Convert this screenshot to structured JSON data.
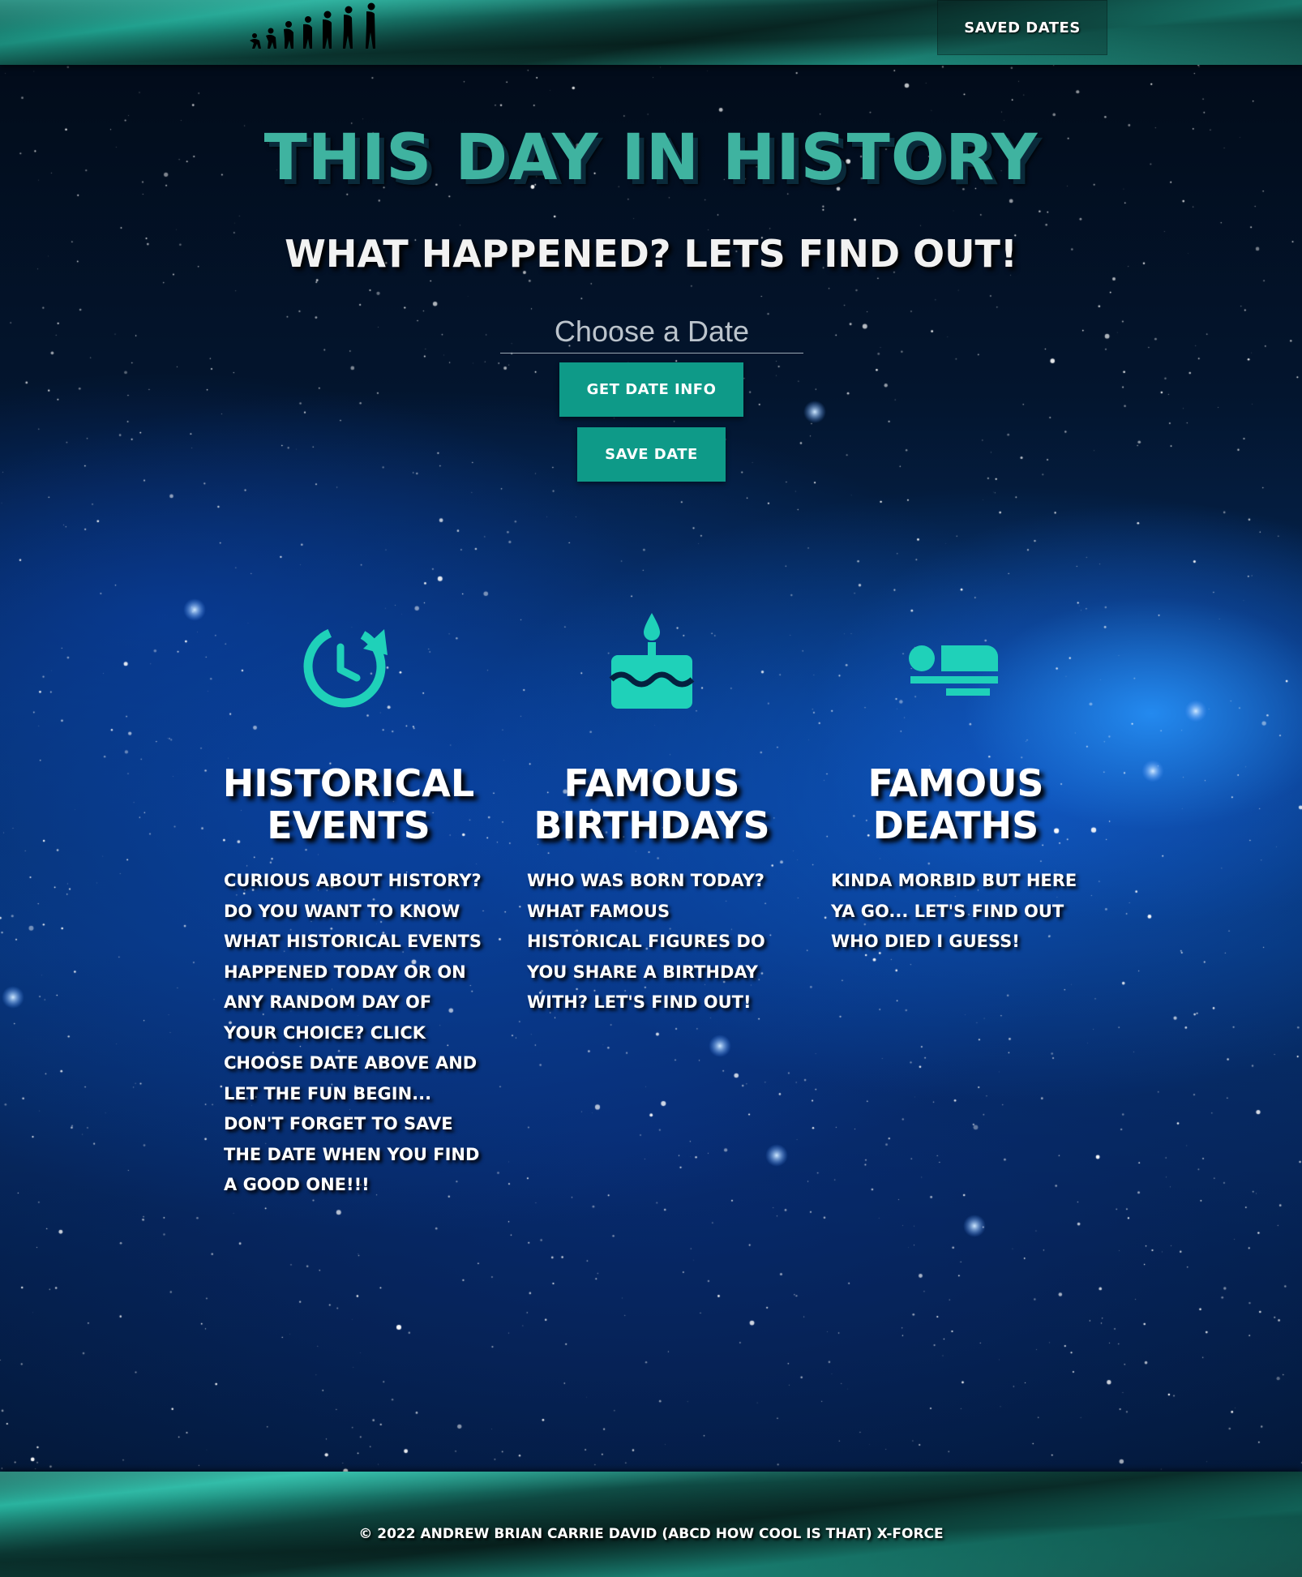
{
  "header": {
    "logo_icon": "evolution-silhouette-icon",
    "saved_dates_label": "Saved Dates"
  },
  "hero": {
    "title": "This Day In History",
    "subtitle": "What Happened? Lets find out!",
    "date_placeholder": "Choose a Date",
    "get_info_label": "Get Date Info",
    "save_label": "Save Date"
  },
  "features": [
    {
      "icon": "clock-history-icon",
      "title_line1": "Historical",
      "title_line2": "Events",
      "text": "Curious about history? Do you want to know what historical events happened today or on any random day of your choice? Click choose date above and let the fun begin... Don't forget to save the date when you find a good one!!!"
    },
    {
      "icon": "birthday-cake-icon",
      "title_line1": "Famous",
      "title_line2": "Birthdays",
      "text": "Who was born today? What famous historical figures do you share a birthday with? Let's find out!"
    },
    {
      "icon": "bed-icon",
      "title_line1": "Famous",
      "title_line2": "Deaths",
      "text": "Kinda morbid but here ya go... Let's find out who died I guess!"
    }
  ],
  "footer": {
    "text": "© 2022 Andrew Brian Carrie David (ABCD how cool is that) X-Force"
  },
  "colors": {
    "accent": "#1fd1b9",
    "title": "#3fb3a0",
    "button": "#0e9a88"
  }
}
